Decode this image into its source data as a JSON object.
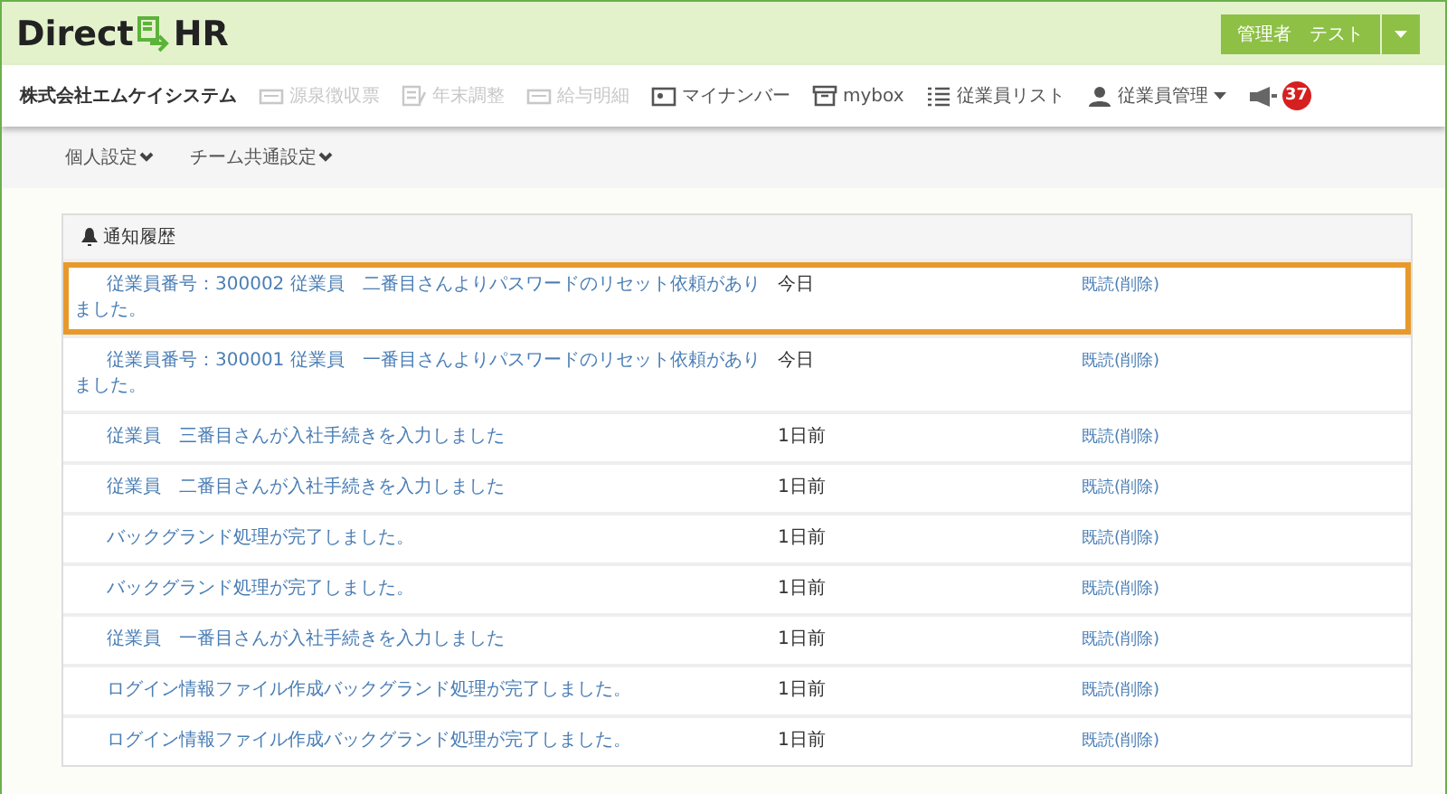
{
  "header": {
    "logo_left": "Direct",
    "logo_right": "HR",
    "user_button": "管理者　テスト"
  },
  "navbar": {
    "company": "株式会社エムケイシステム",
    "items": [
      {
        "label": "源泉徴収票",
        "disabled": true,
        "kind": "link"
      },
      {
        "label": "年末調整",
        "disabled": true,
        "kind": "link"
      },
      {
        "label": "給与明細",
        "disabled": true,
        "kind": "link"
      },
      {
        "label": "マイナンバー",
        "disabled": false,
        "kind": "link"
      },
      {
        "label": "mybox",
        "disabled": false,
        "kind": "link"
      },
      {
        "label": "従業員リスト",
        "disabled": false,
        "kind": "link"
      },
      {
        "label": "従業員管理",
        "disabled": false,
        "kind": "dropdown"
      }
    ],
    "notification_count": "37"
  },
  "subnav": [
    {
      "label": "個人設定"
    },
    {
      "label": "チーム共通設定"
    }
  ],
  "panel": {
    "title": "通知履歴",
    "rows": [
      {
        "message": "従業員番号：300002 従業員　二番目さんよりパスワードのリセット依頼がありました。",
        "time": "今日",
        "action": "既読(削除)",
        "selected": true
      },
      {
        "message": "従業員番号：300001 従業員　一番目さんよりパスワードのリセット依頼がありました。",
        "time": "今日",
        "action": "既読(削除)",
        "selected": false
      },
      {
        "message": "従業員　三番目さんが入社手続きを入力しました",
        "time": "1日前",
        "action": "既読(削除)",
        "selected": false
      },
      {
        "message": "従業員　二番目さんが入社手続きを入力しました",
        "time": "1日前",
        "action": "既読(削除)",
        "selected": false
      },
      {
        "message": "バックグランド処理が完了しました。",
        "time": "1日前",
        "action": "既読(削除)",
        "selected": false
      },
      {
        "message": "バックグランド処理が完了しました。",
        "time": "1日前",
        "action": "既読(削除)",
        "selected": false
      },
      {
        "message": "従業員　一番目さんが入社手続きを入力しました",
        "time": "1日前",
        "action": "既読(削除)",
        "selected": false
      },
      {
        "message": "ログイン情報ファイル作成バックグランド処理が完了しました。",
        "time": "1日前",
        "action": "既読(削除)",
        "selected": false
      },
      {
        "message": "ログイン情報ファイル作成バックグランド処理が完了しました。",
        "time": "1日前",
        "action": "既読(削除)",
        "selected": false
      }
    ]
  }
}
